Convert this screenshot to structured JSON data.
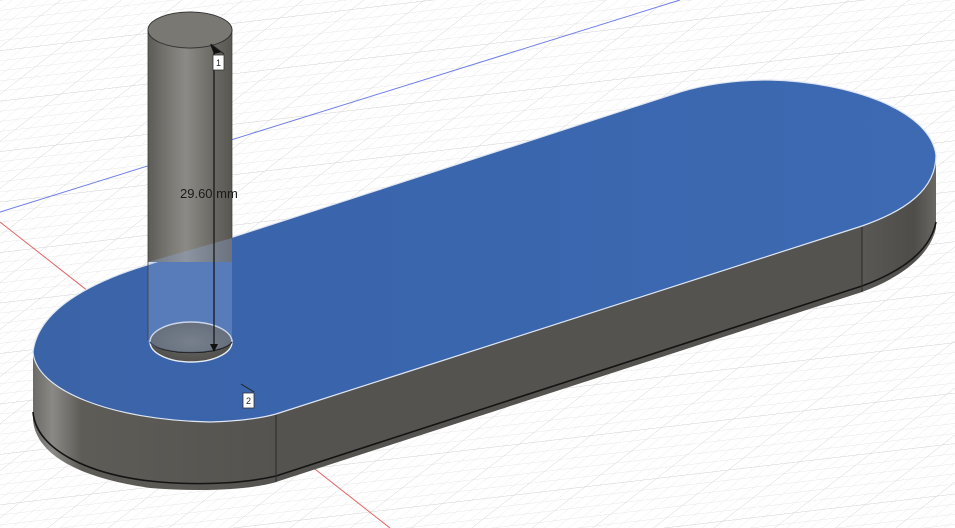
{
  "viewport": {
    "measurement": {
      "value": "29.60",
      "unit": "mm"
    },
    "points": [
      {
        "label": "1"
      },
      {
        "label": "2"
      }
    ],
    "colors": {
      "background": "#ffffff",
      "grid_minor": "#e9e9e9",
      "grid_major": "#d4d4d4",
      "axis_x": "#e06666",
      "axis_y": "#6e7ee8",
      "selected_face": "#3a66ae",
      "body_side": "#5c5a55",
      "body_edge": "#1a1a1a"
    }
  }
}
